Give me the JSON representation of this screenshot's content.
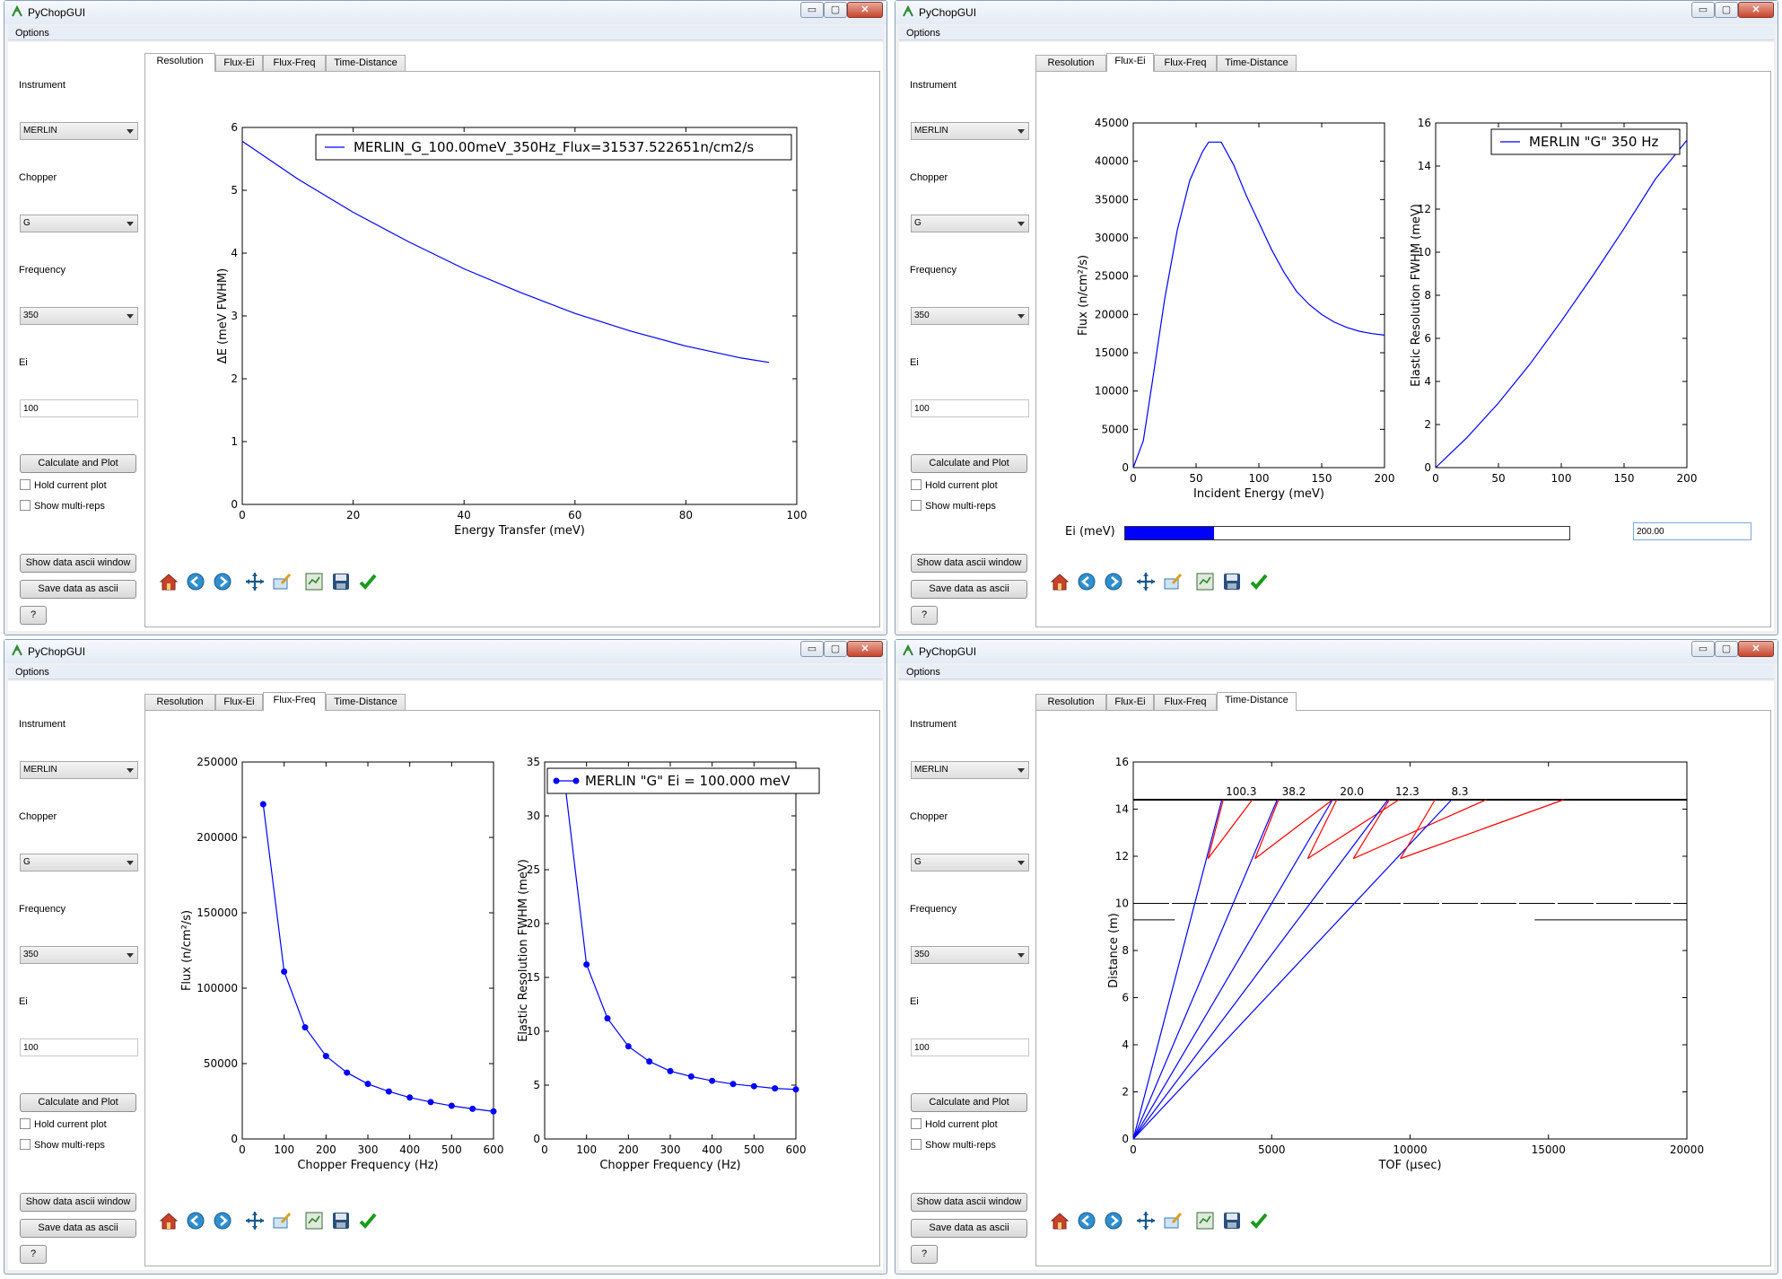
{
  "app": {
    "title": "PyChopGUI",
    "menu": "Options",
    "min": "▭",
    "max": "▢",
    "close": "✕"
  },
  "sidebar": {
    "instrument_label": "Instrument",
    "instrument_value": "MERLIN",
    "chopper_label": "Chopper",
    "chopper_value": "G",
    "frequency_label": "Frequency",
    "frequency_value": "350",
    "ei_label": "Ei",
    "ei_value": "100",
    "calc_button": "Calculate and Plot",
    "hold_label": "Hold current plot",
    "multi_label": "Show multi-reps",
    "show_ascii_button": "Show data ascii window",
    "save_ascii_button": "Save data as ascii",
    "help_button": "?"
  },
  "tabs": [
    "Resolution",
    "Flux-Ei",
    "Flux-Freq",
    "Time-Distance"
  ],
  "toolbar_icons": [
    "home-icon",
    "back-icon",
    "forward-icon",
    "pan-icon",
    "zoom-icon",
    "configure-icon",
    "save-icon",
    "check-icon"
  ],
  "slider": {
    "label": "Ei (meV)",
    "value": "200.00",
    "fill": 0.2,
    "color": "#0000ff"
  },
  "colors": {
    "line": "#0000ff",
    "red": "#ff0000"
  },
  "chart_data": [
    {
      "type": "line",
      "panel": "resolution",
      "xlabel": "Energy Transfer (meV)",
      "ylabel": "ΔE (meV FWHM)",
      "xlim": [
        0,
        100
      ],
      "ylim": [
        0,
        6
      ],
      "xticks": [
        "0",
        "20",
        "40",
        "60",
        "80",
        "100"
      ],
      "yticks": [
        "0",
        "1",
        "2",
        "3",
        "4",
        "5",
        "6"
      ],
      "legend": "top-right",
      "series": [
        {
          "name": "MERLIN_G_100.00meV_350Hz_Flux=31537.522651n/cm2/s",
          "x": [
            0,
            10,
            20,
            30,
            40,
            50,
            60,
            70,
            80,
            90,
            95
          ],
          "y": [
            5.78,
            5.18,
            4.65,
            4.18,
            3.75,
            3.38,
            3.04,
            2.76,
            2.52,
            2.33,
            2.26
          ]
        }
      ]
    },
    {
      "type": "line",
      "panel": "flux-ei",
      "xlabel": "Incident Energy (meV)",
      "ylabel": "Flux (n/cm²/s)",
      "xlim": [
        0,
        200
      ],
      "ylim": [
        0,
        45000
      ],
      "xticks": [
        "0",
        "50",
        "100",
        "150",
        "200"
      ],
      "yticks": [
        "0",
        "5000",
        "10000",
        "15000",
        "20000",
        "25000",
        "30000",
        "35000",
        "40000",
        "45000"
      ],
      "series": [
        {
          "name": "",
          "x": [
            0,
            8,
            15,
            25,
            35,
            45,
            55,
            60,
            70,
            80,
            90,
            100,
            110,
            120,
            130,
            140,
            150,
            160,
            170,
            180,
            190,
            200
          ],
          "y": [
            0,
            3500,
            11000,
            22000,
            31000,
            37500,
            41200,
            42500,
            42500,
            39500,
            35500,
            32000,
            28500,
            25500,
            23000,
            21300,
            20000,
            19000,
            18300,
            17800,
            17500,
            17300
          ]
        }
      ]
    },
    {
      "type": "line",
      "panel": "flux-ei-resolution",
      "xlabel": "",
      "ylabel": "Elastic Resolution FWHM (meV)",
      "xlim": [
        0,
        200
      ],
      "ylim": [
        0,
        16
      ],
      "xticks": [
        "0",
        "50",
        "100",
        "150",
        "200"
      ],
      "yticks": [
        "0",
        "2",
        "4",
        "6",
        "8",
        "10",
        "12",
        "14",
        "16"
      ],
      "legend": "top-right",
      "series": [
        {
          "name": "MERLIN \"G\" 350 Hz",
          "x": [
            0,
            25,
            50,
            75,
            100,
            125,
            150,
            175,
            200
          ],
          "y": [
            0,
            1.4,
            3.0,
            4.8,
            6.8,
            8.9,
            11.1,
            13.4,
            15.2
          ]
        }
      ]
    },
    {
      "type": "line",
      "panel": "flux-freq",
      "xlabel": "Chopper Frequency (Hz)",
      "ylabel": "Flux (n/cm²/s)",
      "xlim": [
        0,
        600
      ],
      "ylim": [
        0,
        250000
      ],
      "xticks": [
        "0",
        "100",
        "200",
        "300",
        "400",
        "500",
        "600"
      ],
      "yticks": [
        "0",
        "50000",
        "100000",
        "150000",
        "200000",
        "250000"
      ],
      "series": [
        {
          "name": "",
          "x": [
            50,
            100,
            150,
            200,
            250,
            300,
            350,
            400,
            450,
            500,
            550,
            600
          ],
          "y": [
            222000,
            111000,
            74000,
            55000,
            44000,
            36500,
            31500,
            27500,
            24500,
            22000,
            20000,
            18300
          ]
        }
      ]
    },
    {
      "type": "line",
      "panel": "flux-freq-resolution",
      "xlabel": "Chopper Frequency (Hz)",
      "ylabel": "Elastic Resolution FWHM (meV)",
      "xlim": [
        0,
        600
      ],
      "ylim": [
        0,
        35
      ],
      "xticks": [
        "0",
        "100",
        "200",
        "300",
        "400",
        "500",
        "600"
      ],
      "yticks": [
        "0",
        "5",
        "10",
        "15",
        "20",
        "25",
        "30",
        "35"
      ],
      "legend": "top-right",
      "series": [
        {
          "name": "MERLIN \"G\" Ei = 100.000 meV",
          "x": [
            50,
            100,
            150,
            200,
            250,
            300,
            350,
            400,
            450,
            500,
            550,
            600
          ],
          "y": [
            32.5,
            16.2,
            11.2,
            8.6,
            7.2,
            6.3,
            5.8,
            5.4,
            5.1,
            4.9,
            4.7,
            4.6
          ]
        }
      ]
    },
    {
      "type": "line",
      "panel": "time-distance",
      "xlabel": "TOF (μsec)",
      "ylabel": "Distance (m)",
      "xlim": [
        0,
        20000
      ],
      "ylim": [
        0,
        16
      ],
      "xticks": [
        "0",
        "5000",
        "10000",
        "15000",
        "20000"
      ],
      "yticks": [
        "0",
        "2",
        "4",
        "6",
        "8",
        "10",
        "12",
        "14",
        "16"
      ],
      "rep_labels": [
        "100.3",
        "38.2",
        "20.0",
        "12.3",
        "8.3"
      ],
      "rep_label_x": [
        3900,
        5800,
        7900,
        9900,
        11800
      ],
      "blue_end": [
        3200,
        5200,
        7200,
        9200,
        11500
      ],
      "red_start": [
        2700,
        4400,
        6300,
        7950,
        9650
      ],
      "red_end": [
        [
          3250,
          4300
        ],
        [
          5250,
          7200
        ],
        [
          7350,
          9600
        ],
        [
          9250,
          12750
        ],
        [
          10900,
          15550
        ]
      ]
    }
  ]
}
